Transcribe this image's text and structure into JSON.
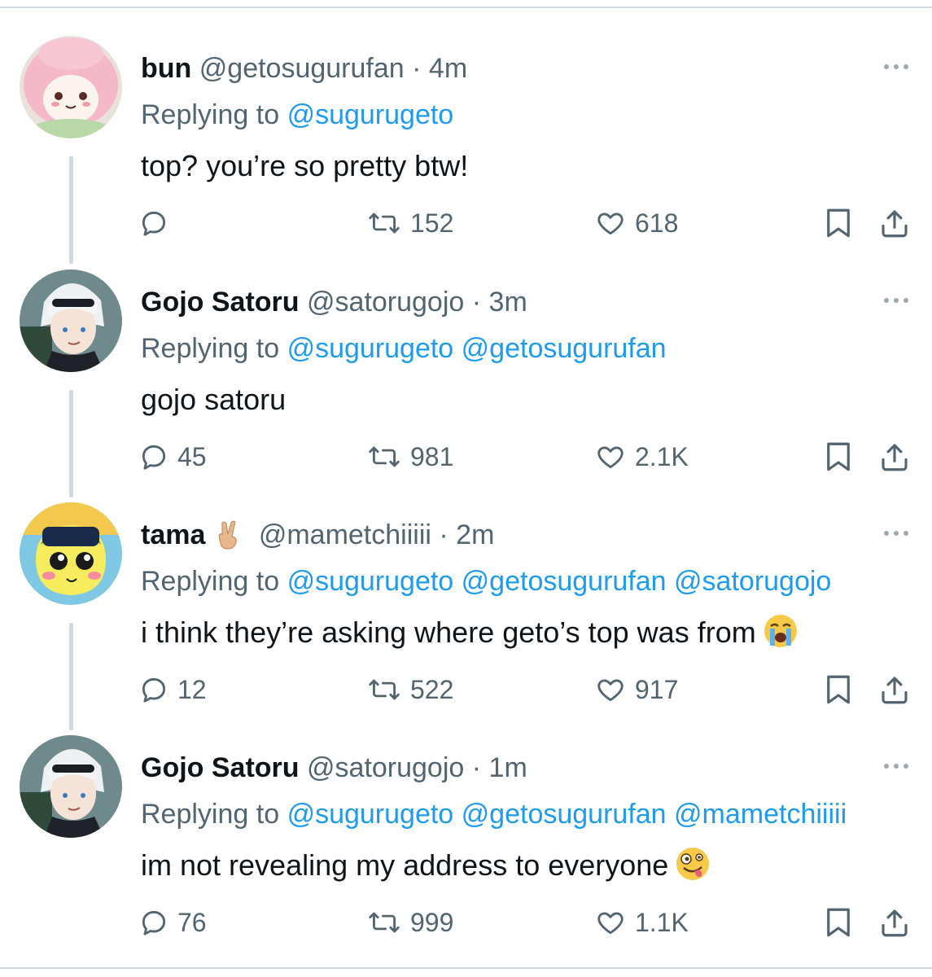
{
  "tweets": [
    {
      "name": "bun",
      "handle": "@getosugurufan",
      "time": "4m",
      "replying_prefix": "Replying to",
      "mentions": [
        "@sugurugeto"
      ],
      "text": "top? you’re so pretty btw!",
      "replies": "",
      "retweets": "152",
      "likes": "618"
    },
    {
      "name": "Gojo Satoru",
      "handle": "@satorugojo",
      "time": "3m",
      "replying_prefix": "Replying to",
      "mentions": [
        "@sugurugeto",
        "@getosugurufan"
      ],
      "text": "gojo satoru",
      "replies": "45",
      "retweets": "981",
      "likes": "2.1K"
    },
    {
      "name": "tama",
      "name_emoji": "victory-hand",
      "handle": "@mametchiiiii",
      "time": "2m",
      "replying_prefix": "Replying to",
      "mentions": [
        "@sugurugeto",
        "@getosugurufan",
        "@satorugojo"
      ],
      "text": "i think they’re asking where geto’s top was from",
      "text_emoji": "loudly-crying-face",
      "replies": "12",
      "retweets": "522",
      "likes": "917"
    },
    {
      "name": "Gojo Satoru",
      "handle": "@satorugojo",
      "time": "1m",
      "replying_prefix": "Replying to",
      "mentions": [
        "@sugurugeto",
        "@getosugurufan",
        "@mametchiiiii"
      ],
      "text": "im not revealing my address to everyone",
      "text_emoji": "zany-face",
      "replies": "76",
      "retweets": "999",
      "likes": "1.1K"
    }
  ],
  "separator": "·",
  "colors": {
    "text": "#0f1419",
    "secondary": "#536471",
    "link": "#1d9bf0",
    "line": "#cfd9de"
  }
}
